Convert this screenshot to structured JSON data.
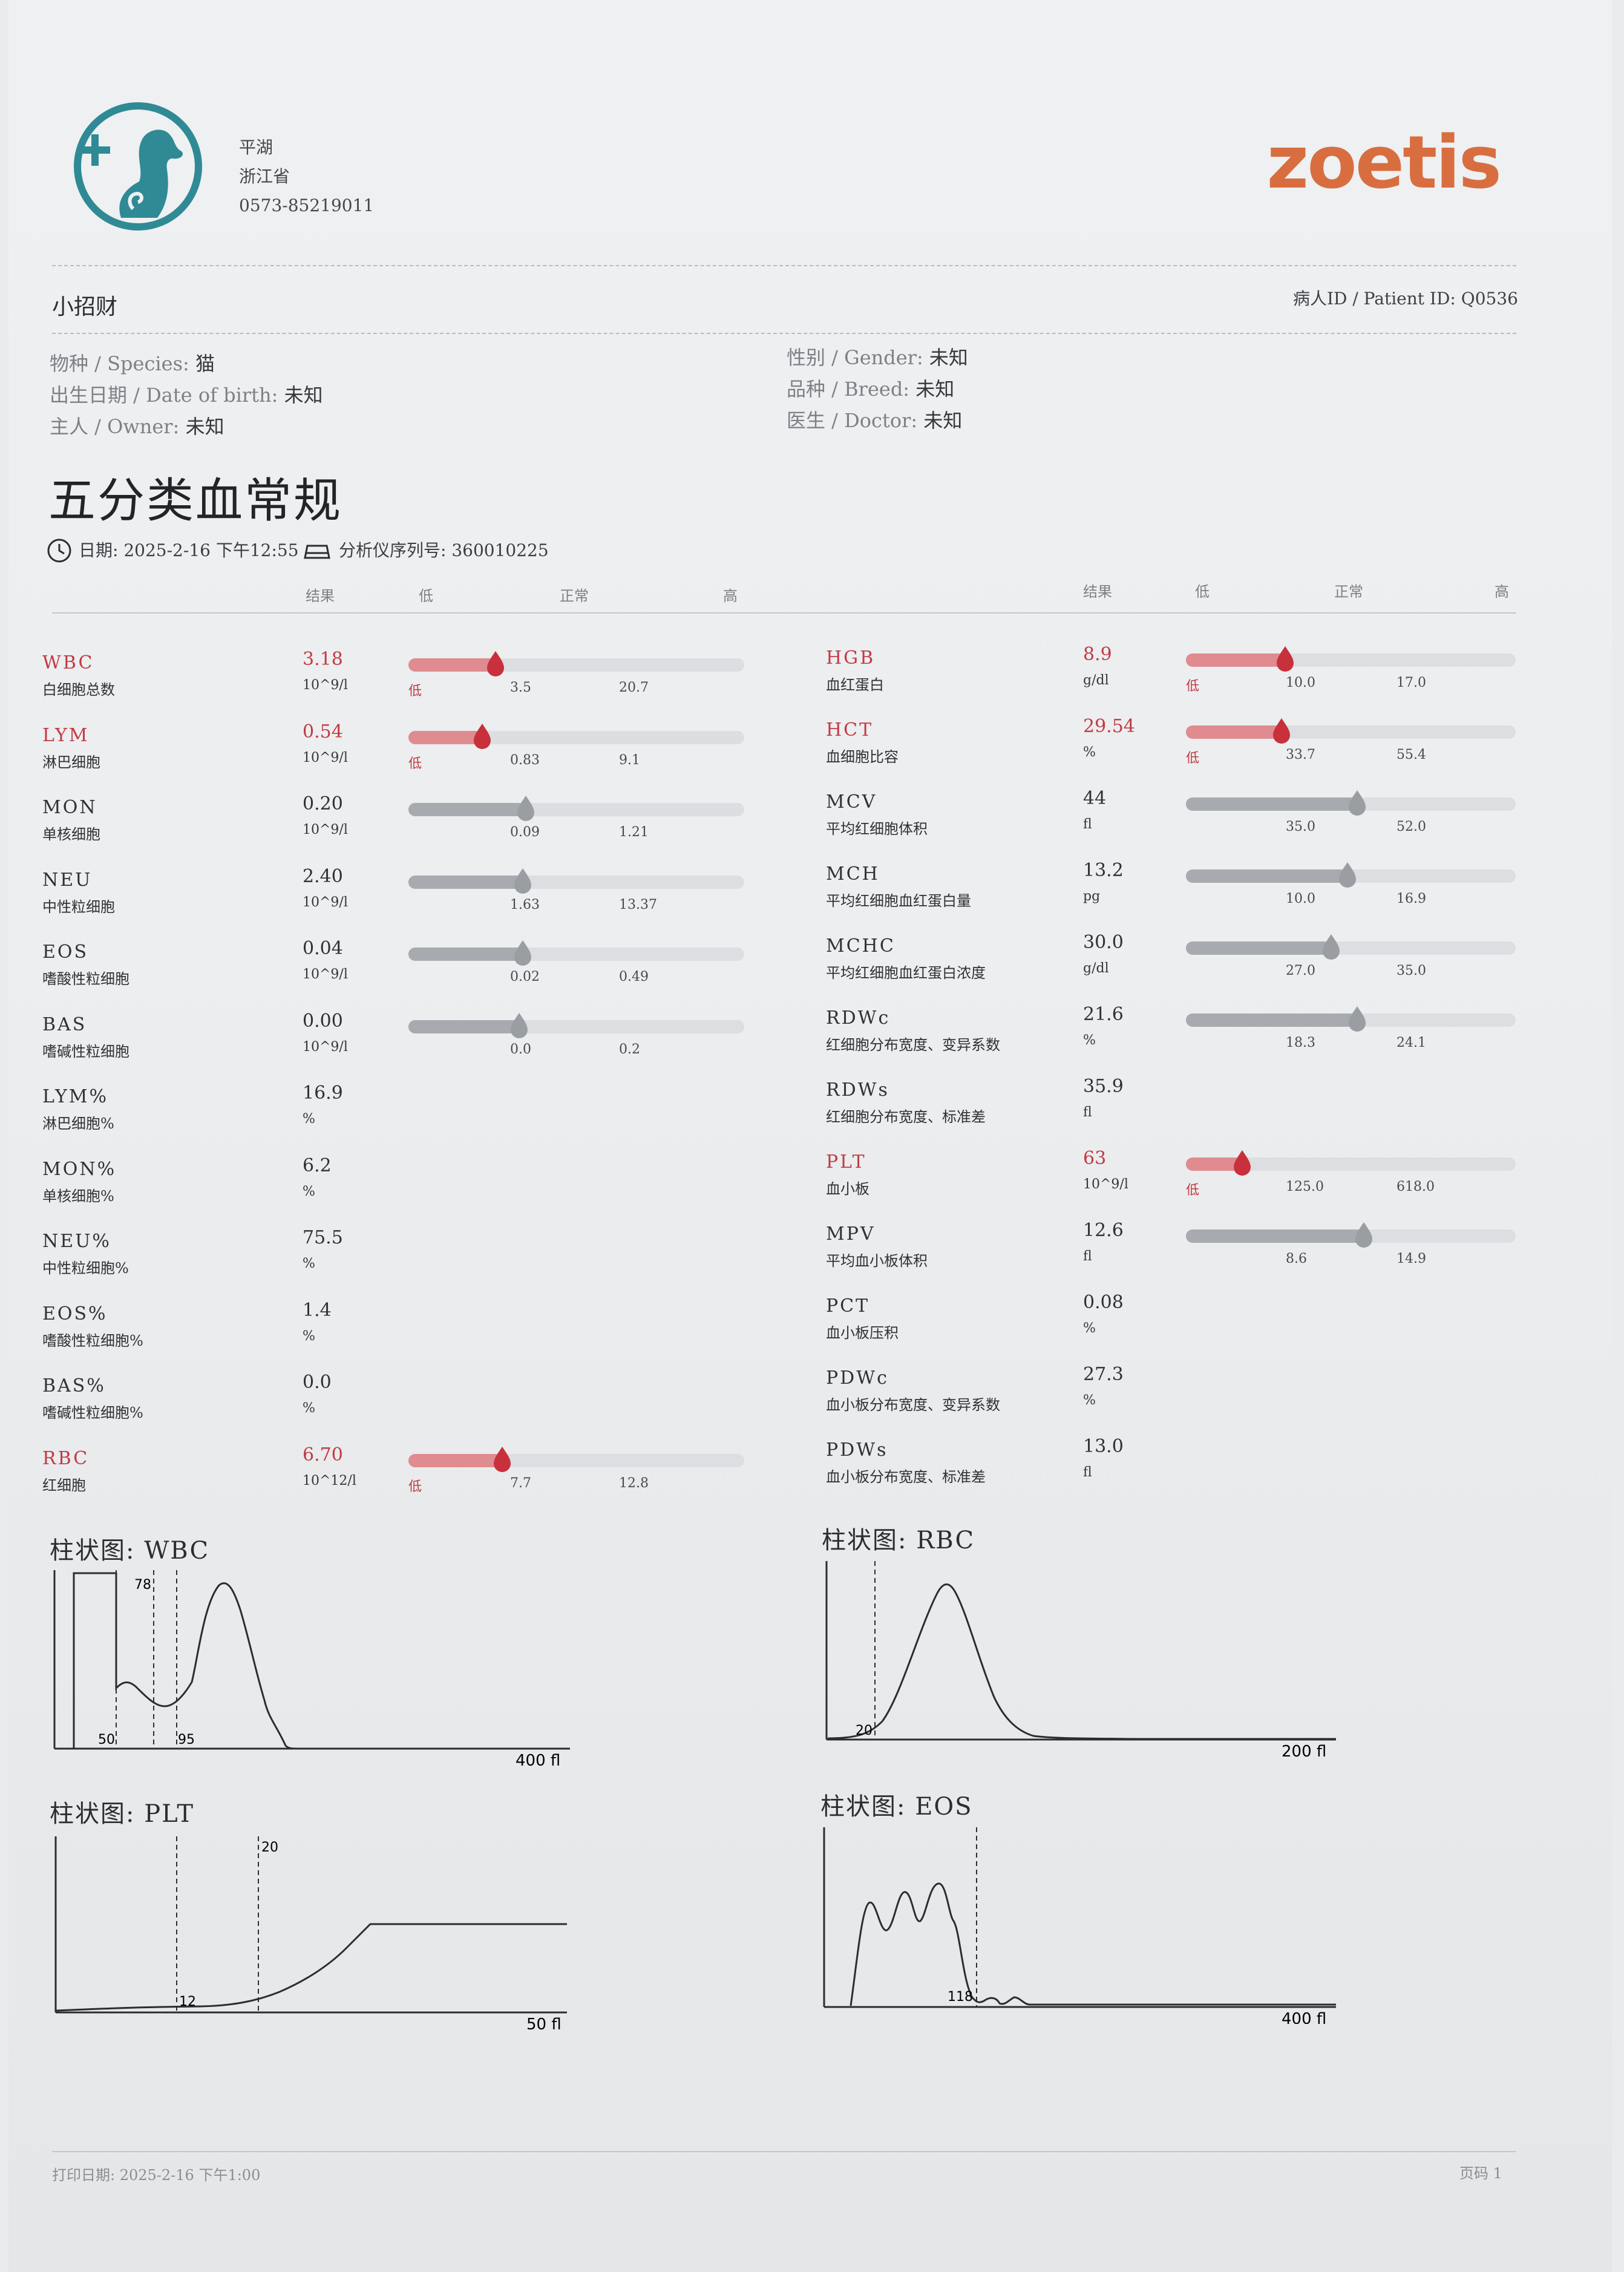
{
  "clinic": {
    "line1": "平湖",
    "line2": "浙江省",
    "phone": "0573-85219011"
  },
  "brand": "zoetis",
  "patient": {
    "name": "小招财",
    "id_label": "病人ID / Patient ID:",
    "id_value": "Q0536",
    "species_label": "物种 / Species:",
    "species": "猫",
    "dob_label": "出生日期 / Date of birth:",
    "dob": "未知",
    "owner_label": "主人 / Owner:",
    "owner": "未知",
    "gender_label": "性别 / Gender:",
    "gender": "未知",
    "breed_label": "品种 / Breed:",
    "breed": "未知",
    "doctor_label": "医生 / Doctor:",
    "doctor": "未知"
  },
  "report": {
    "title": "五分类血常规",
    "date": "日期: 2025-2-16 下午12:55",
    "analyzer": "分析仪序列号: 360010225"
  },
  "col_headers": {
    "result": "结果",
    "low": "低",
    "normal": "正常",
    "high": "高"
  },
  "low_flag": "低",
  "left_rows": [
    {
      "code": "WBC",
      "name": "白细胞总数",
      "value": "3.18",
      "unit": "10^9/l",
      "ref_low": "3.5",
      "ref_high": "20.7",
      "status": "low",
      "level": 0.26
    },
    {
      "code": "LYM",
      "name": "淋巴细胞",
      "value": "0.54",
      "unit": "10^9/l",
      "ref_low": "0.83",
      "ref_high": "9.1",
      "status": "low",
      "level": 0.22
    },
    {
      "code": "MON",
      "name": "单核细胞",
      "value": "0.20",
      "unit": "10^9/l",
      "ref_low": "0.09",
      "ref_high": "1.21",
      "status": "normal",
      "level": 0.35
    },
    {
      "code": "NEU",
      "name": "中性粒细胞",
      "value": "2.40",
      "unit": "10^9/l",
      "ref_low": "1.63",
      "ref_high": "13.37",
      "status": "normal",
      "level": 0.34
    },
    {
      "code": "EOS",
      "name": "嗜酸性粒细胞",
      "value": "0.04",
      "unit": "10^9/l",
      "ref_low": "0.02",
      "ref_high": "0.49",
      "status": "normal",
      "level": 0.34
    },
    {
      "code": "BAS",
      "name": "嗜碱性粒细胞",
      "value": "0.00",
      "unit": "10^9/l",
      "ref_low": "0.0",
      "ref_high": "0.2",
      "status": "normal",
      "level": 0.33
    },
    {
      "code": "LYM%",
      "name": "淋巴细胞%",
      "value": "16.9",
      "unit": "%"
    },
    {
      "code": "MON%",
      "name": "单核细胞%",
      "value": "6.2",
      "unit": "%"
    },
    {
      "code": "NEU%",
      "name": "中性粒细胞%",
      "value": "75.5",
      "unit": "%"
    },
    {
      "code": "EOS%",
      "name": "嗜酸性粒细胞%",
      "value": "1.4",
      "unit": "%"
    },
    {
      "code": "BAS%",
      "name": "嗜碱性粒细胞%",
      "value": "0.0",
      "unit": "%"
    },
    {
      "code": "RBC",
      "name": "红细胞",
      "value": "6.70",
      "unit": "10^12/l",
      "ref_low": "7.7",
      "ref_high": "12.8",
      "status": "low",
      "level": 0.28
    }
  ],
  "right_rows": [
    {
      "code": "HGB",
      "name": "血红蛋白",
      "value": "8.9",
      "unit": "g/dl",
      "ref_low": "10.0",
      "ref_high": "17.0",
      "status": "low",
      "level": 0.3
    },
    {
      "code": "HCT",
      "name": "血细胞比容",
      "value": "29.54",
      "unit": "%",
      "ref_low": "33.7",
      "ref_high": "55.4",
      "status": "low",
      "level": 0.29
    },
    {
      "code": "MCV",
      "name": "平均红细胞体积",
      "value": "44",
      "unit": "fl",
      "ref_low": "35.0",
      "ref_high": "52.0",
      "status": "normal",
      "level": 0.52
    },
    {
      "code": "MCH",
      "name": "平均红细胞血红蛋白量",
      "value": "13.2",
      "unit": "pg",
      "ref_low": "10.0",
      "ref_high": "16.9",
      "status": "normal",
      "level": 0.49
    },
    {
      "code": "MCHC",
      "name": "平均红细胞血红蛋白浓度",
      "value": "30.0",
      "unit": "g/dl",
      "ref_low": "27.0",
      "ref_high": "35.0",
      "status": "normal",
      "level": 0.44
    },
    {
      "code": "RDWc",
      "name": "红细胞分布宽度、变异系数",
      "value": "21.6",
      "unit": "%",
      "ref_low": "18.3",
      "ref_high": "24.1",
      "status": "normal",
      "level": 0.52
    },
    {
      "code": "RDWs",
      "name": "红细胞分布宽度、标准差",
      "value": "35.9",
      "unit": "fl"
    },
    {
      "code": "PLT",
      "name": "血小板",
      "value": "63",
      "unit": "10^9/l",
      "ref_low": "125.0",
      "ref_high": "618.0",
      "status": "low",
      "level": 0.17
    },
    {
      "code": "MPV",
      "name": "平均血小板体积",
      "value": "12.6",
      "unit": "fl",
      "ref_low": "8.6",
      "ref_high": "14.9",
      "status": "normal",
      "level": 0.54
    },
    {
      "code": "PCT",
      "name": "血小板压积",
      "value": "0.08",
      "unit": "%"
    },
    {
      "code": "PDWc",
      "name": "血小板分布宽度、变异系数",
      "value": "27.3",
      "unit": "%"
    },
    {
      "code": "PDWs",
      "name": "血小板分布宽度、标准差",
      "value": "13.0",
      "unit": "fl"
    }
  ],
  "histograms": [
    {
      "title": "柱状图: WBC",
      "axis_label": "400 fl",
      "markers": [
        "50",
        "78",
        "95"
      ]
    },
    {
      "title": "柱状图: RBC",
      "axis_label": "200 fl",
      "markers": [
        "20"
      ]
    },
    {
      "title": "柱状图: PLT",
      "axis_label": "50 fl",
      "markers": [
        "12",
        "20"
      ]
    },
    {
      "title": "柱状图: EOS",
      "axis_label": "400 fl",
      "markers": [
        "118"
      ]
    }
  ],
  "footer": {
    "printed": "打印日期: 2025-2-16 下午1:00",
    "page": "页码 1"
  },
  "colors": {
    "brand": "#d86e3f",
    "flag_low": "#c23a43",
    "logo": "#2f8a95"
  }
}
